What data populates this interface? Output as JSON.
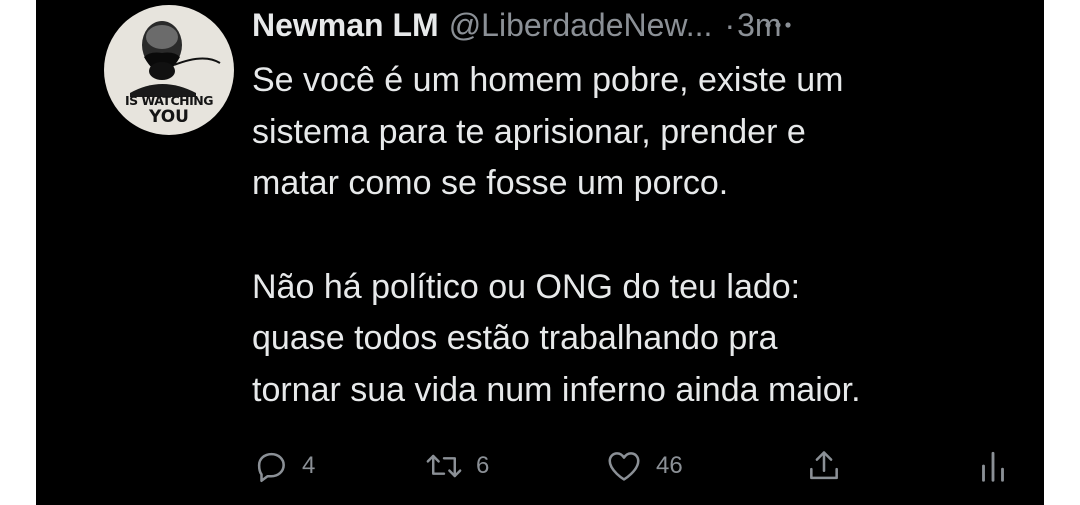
{
  "tweet": {
    "author_name": "Newman LM",
    "author_handle": "@LiberdadeNew...",
    "separator": "·",
    "time_ago": "3m",
    "avatar": {
      "line1": "IS WATCHING",
      "line2": "YOU"
    },
    "paragraphs": [
      [
        "Se você é um homem pobre, existe um",
        "sistema para te aprisionar, prender e",
        "matar como se fosse um porco."
      ],
      [
        "Não há político ou ONG do teu lado:",
        "quase todos estão trabalhando pra",
        "tornar sua vida num inferno ainda maior."
      ]
    ],
    "replies": "4",
    "retweets": "6",
    "likes": "46"
  },
  "colors": {
    "background": "#000000",
    "text_primary": "#e7e9ea",
    "text_secondary": "#8b9096"
  },
  "icons": [
    "more-icon",
    "reply-icon",
    "retweet-icon",
    "like-icon",
    "share-icon",
    "analytics-icon"
  ]
}
